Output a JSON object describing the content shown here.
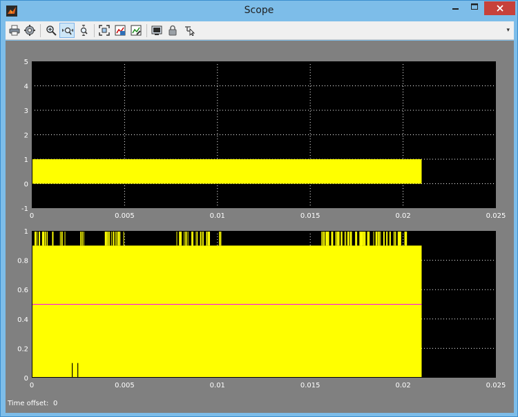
{
  "window": {
    "title": "Scope"
  },
  "toolbar": {
    "buttons": [
      "print-icon",
      "parameters-icon",
      "zoom-icon",
      "zoom-x-icon",
      "zoom-y-icon",
      "autoscale-icon",
      "save-axes-icon",
      "restore-axes-icon",
      "floating-scope-icon",
      "lock-icon",
      "signal-selection-icon"
    ]
  },
  "status": {
    "time_offset_label": "Time offset:",
    "time_offset_value": "0"
  },
  "colors": {
    "background": "#808080",
    "axes": "#000000",
    "signal": "#ffff00",
    "threshold": "#ff00ff",
    "grid": "#ffffff"
  },
  "chart_data": [
    {
      "type": "line",
      "title": "",
      "xlim": [
        0,
        0.025
      ],
      "ylim": [
        -1,
        5
      ],
      "x_ticks": [
        "0",
        "0.005",
        "0.01",
        "0.015",
        "0.02",
        "0.025"
      ],
      "y_ticks": [
        "5",
        "4",
        "3",
        "2",
        "1",
        "0",
        "-1"
      ],
      "grid": true,
      "series": [
        {
          "color": "#ffff00",
          "description": "fast switching 0/1 signal",
          "x_range": [
            0,
            0.021
          ],
          "y_range": [
            0,
            1
          ]
        }
      ]
    },
    {
      "type": "line",
      "title": "",
      "xlim": [
        0,
        0.025
      ],
      "ylim": [
        0,
        1
      ],
      "x_ticks": [
        "0",
        "0.005",
        "0.01",
        "0.015",
        "0.02",
        "0.025"
      ],
      "y_ticks": [
        "1",
        "0.8",
        "0.6",
        "0.4",
        "0.2",
        "0"
      ],
      "grid": true,
      "series": [
        {
          "color": "#ffff00",
          "description": "noisy signal",
          "x_range": [
            0,
            0.021
          ],
          "y_range": [
            0,
            1
          ]
        },
        {
          "color": "#ff00ff",
          "description": "constant level",
          "x_range": [
            0,
            0.021
          ],
          "y": 0.5
        }
      ]
    }
  ]
}
